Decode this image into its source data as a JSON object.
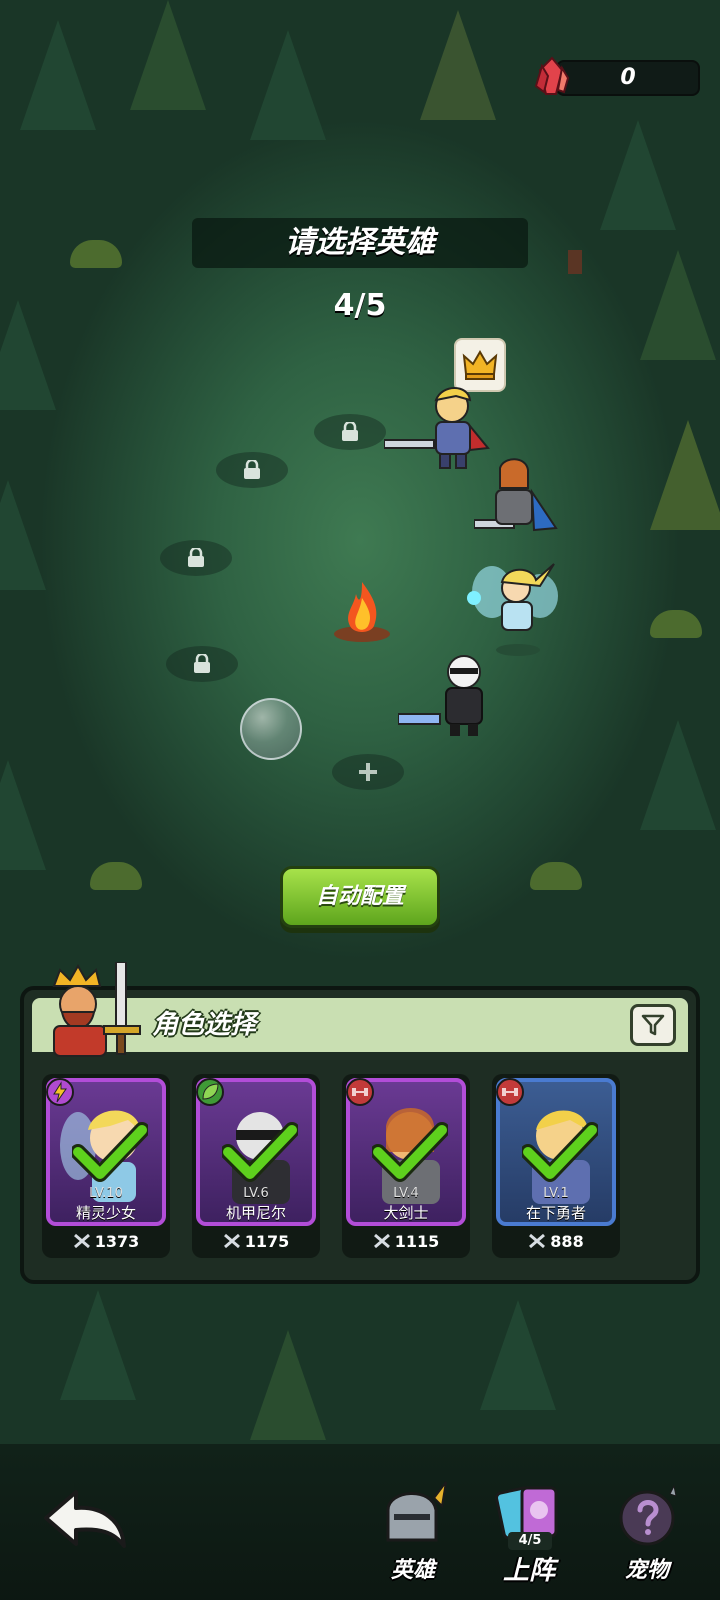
{
  "currency": {
    "icon": "red-crystal-icon",
    "value": "0"
  },
  "header": {
    "title": "请选择英雄",
    "progress": "4/5"
  },
  "formation": {
    "leader_badge_icon": "crown-icon",
    "locked_slots": 4,
    "empty_slot_icon": "plus-icon"
  },
  "auto_button": {
    "label": "自动配置"
  },
  "character_panel": {
    "title": "角色选择",
    "filter_icon": "filter-icon",
    "cards": [
      {
        "level": "LV.10",
        "name": "精灵少女",
        "power": "1373",
        "rarity": "purple",
        "badge_icon": "lightning-icon",
        "badge_color": "#b04ad0",
        "selected": true
      },
      {
        "level": "LV.6",
        "name": "机甲尼尔",
        "power": "1175",
        "rarity": "purple",
        "badge_icon": "leaf-icon",
        "badge_color": "#3f9a36",
        "selected": true
      },
      {
        "level": "LV.4",
        "name": "大剑士",
        "power": "1115",
        "rarity": "purple",
        "badge_icon": "dumbbell-icon",
        "badge_color": "#c23a3a",
        "selected": true
      },
      {
        "level": "LV.1",
        "name": "在下勇者",
        "power": "888",
        "rarity": "blue",
        "badge_icon": "dumbbell-icon",
        "badge_color": "#c23a3a",
        "selected": true
      }
    ]
  },
  "bottom_nav": {
    "back_icon": "back-arrow-icon",
    "items": [
      {
        "label": "英雄",
        "icon": "knight-helmet-icon"
      },
      {
        "label": "上阵",
        "icon": "cards-icon",
        "count": "4/5",
        "active": true
      },
      {
        "label": "宠物",
        "icon": "mystery-egg-icon"
      }
    ]
  },
  "colors": {
    "accent_green": "#7cc234",
    "card_purple": "#b24dd8",
    "card_blue": "#4a7bd1",
    "check_green": "#5ed11d"
  }
}
